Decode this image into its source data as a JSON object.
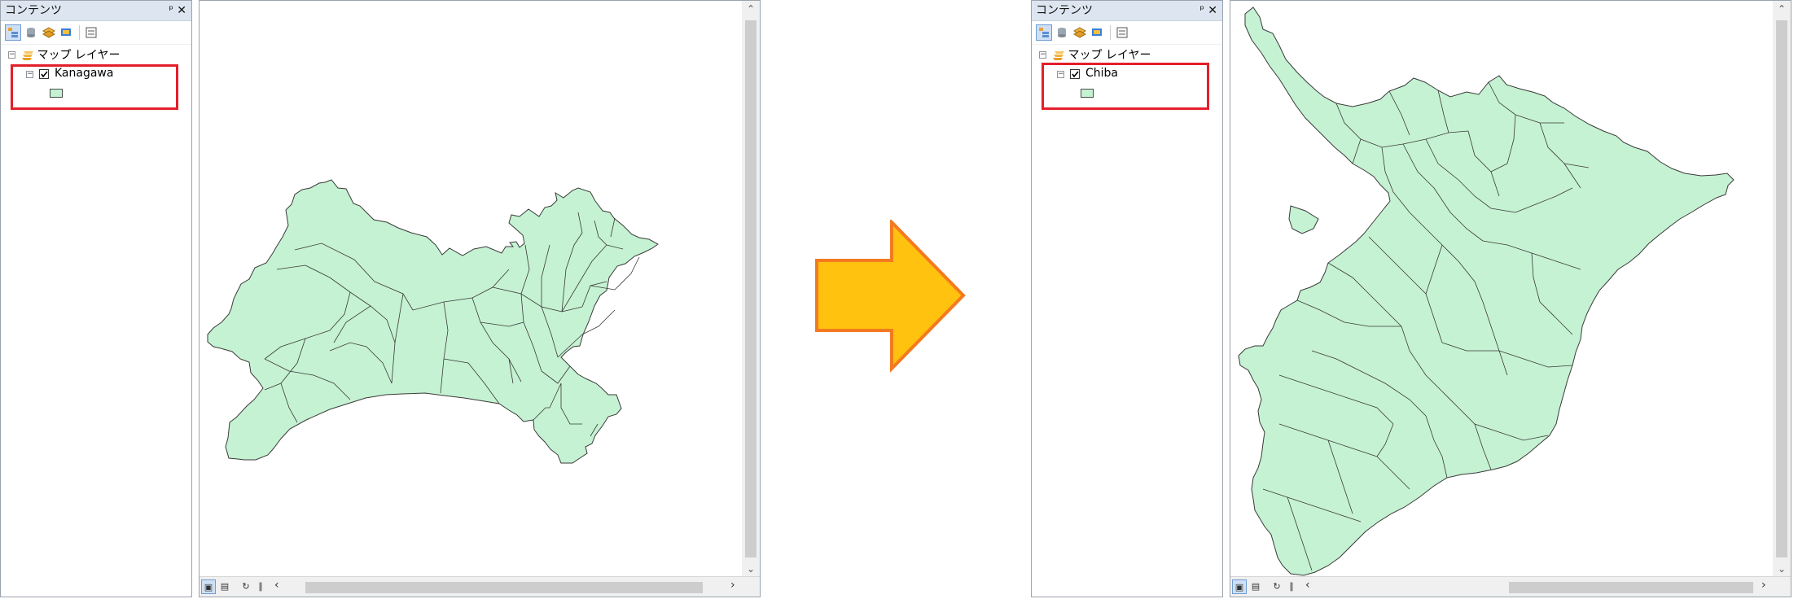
{
  "left": {
    "toc": {
      "title": "コンテンツ",
      "pin_glyph": "ᵖ",
      "close_glyph": "✕",
      "root_label": "マップ レイヤー",
      "layer_label": "Kanagawa",
      "layer_checked": true,
      "fill_color": "#c5f2d2"
    }
  },
  "right": {
    "toc": {
      "title": "コンテンツ",
      "pin_glyph": "ᵖ",
      "close_glyph": "✕",
      "root_label": "マップ レイヤー",
      "layer_label": "Chiba",
      "layer_checked": true,
      "fill_color": "#c5f2d2"
    }
  },
  "arrow": {
    "fill": "#ffc20e",
    "stroke": "#f47a20"
  },
  "highlight_color": "#e41f2a"
}
